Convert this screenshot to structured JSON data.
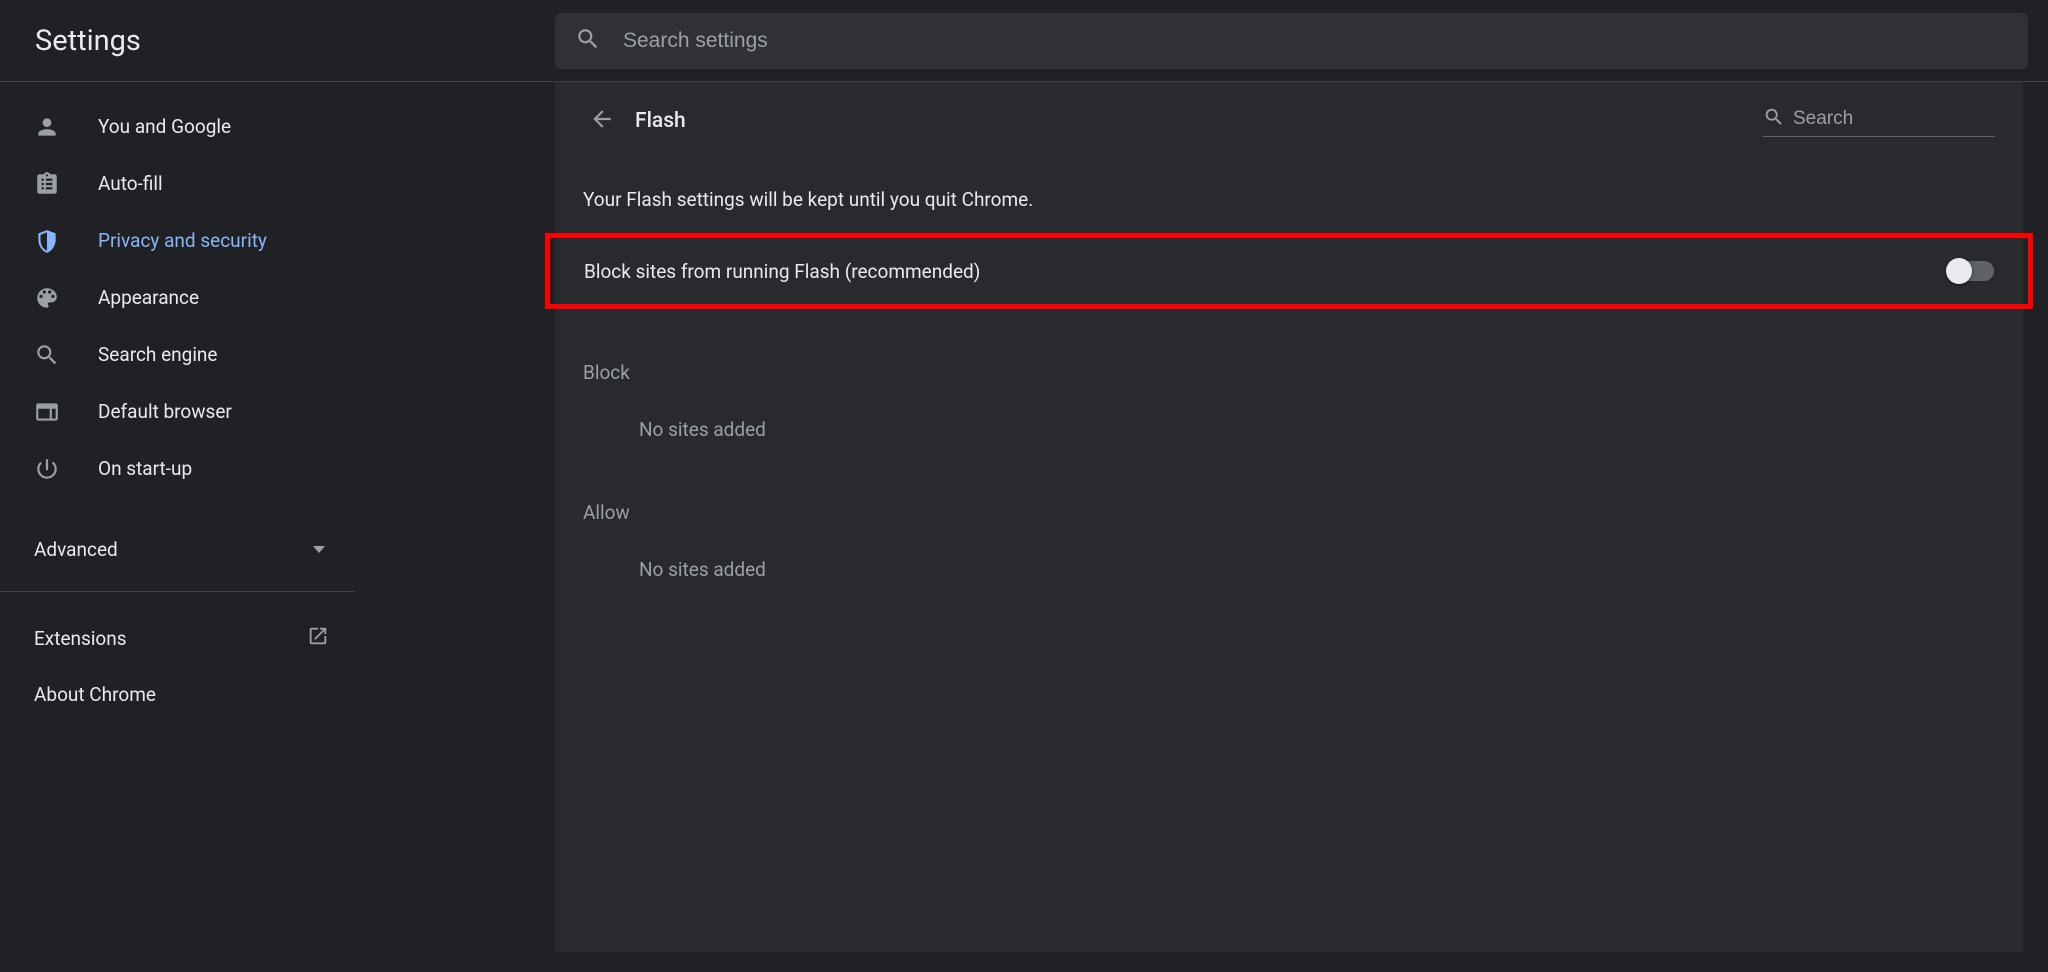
{
  "header": {
    "title": "Settings",
    "search_placeholder": "Search settings"
  },
  "sidebar": {
    "items": [
      {
        "id": "you-google",
        "label": "You and Google",
        "icon": "person"
      },
      {
        "id": "autofill",
        "label": "Auto-fill",
        "icon": "clipboard"
      },
      {
        "id": "privacy",
        "label": "Privacy and security",
        "icon": "shield",
        "active": true
      },
      {
        "id": "appearance",
        "label": "Appearance",
        "icon": "palette"
      },
      {
        "id": "search-engine",
        "label": "Search engine",
        "icon": "search"
      },
      {
        "id": "default-browser",
        "label": "Default browser",
        "icon": "browser"
      },
      {
        "id": "startup",
        "label": "On start-up",
        "icon": "power"
      }
    ],
    "advanced_label": "Advanced",
    "extensions_label": "Extensions",
    "about_label": "About Chrome"
  },
  "main": {
    "page_title": "Flash",
    "search_placeholder": "Search",
    "info_text": "Your Flash settings will be kept until you quit Chrome.",
    "block_toggle_label": "Block sites from running Flash (recommended)",
    "block_toggle_on": false,
    "block_section_label": "Block",
    "block_empty_text": "No sites added",
    "allow_section_label": "Allow",
    "allow_empty_text": "No sites added"
  },
  "annotation": {
    "highlight": "block-flash-toggle-row"
  }
}
